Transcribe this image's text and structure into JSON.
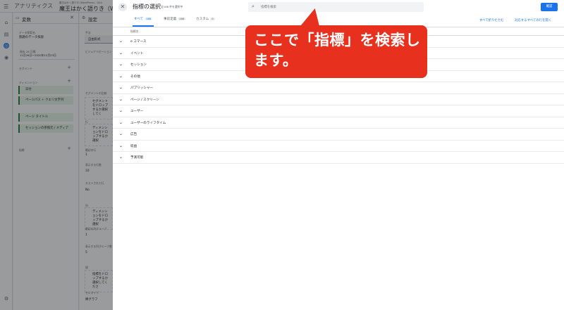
{
  "app": {
    "name": "アナリティクス",
    "property_small": "魔王はかく語りき (WordPress) - GA4",
    "property_title": "魔王はかく語りき（Wo"
  },
  "variables_panel": {
    "title": "変数",
    "exploration_name_label": "データ探索名:",
    "exploration_name": "無題のデータ探索",
    "date_label": "過去 28 日間",
    "date_range": "11月26日～2020年12月23日",
    "segments_label": "セグメント",
    "dimensions_label": "ディメンション",
    "dimensions": [
      "日付",
      "ページパス + クエリ文字列",
      "ページ タイトル",
      "セッションの参照元 / メディア"
    ],
    "metrics_label": "指標"
  },
  "settings_panel": {
    "title": "設定",
    "technique_label": "手法",
    "technique": "自由形式",
    "viz_label": "ビジュアリゼーション",
    "segment_compare_label": "セグメントの比較",
    "segment_drop": "セグメントをドロップするか選択してく",
    "rows_label": "行",
    "rows_drop": "ディメンションをドロップするか選択",
    "start_row_label": "最初の行",
    "start_row": "1",
    "show_rows_label": "表示する行数",
    "show_rows": "10",
    "nested_label": "ネストされた行",
    "nested": "No",
    "cols_label": "列",
    "cols_drop": "ディメンションをドロップするか選択",
    "start_col_group_label": "最初の列グループ",
    "start_col_group": "1",
    "show_col_groups_label": "表示する列グループ数",
    "show_col_groups": "5",
    "values_label": "値",
    "values_drop": "指標をドロップするか選択してくださ",
    "cell_type_label": "セルタイプ",
    "cell_type": "棒グラフ"
  },
  "drawer": {
    "title": "指標の選択",
    "subtitle": "全168 件を選択中",
    "search_placeholder": "指標を検索",
    "apply_label": "確認",
    "tabs": [
      {
        "label": "すべて",
        "count": "168"
      },
      {
        "label": "事前定義",
        "count": "168"
      },
      {
        "label": "カスタム",
        "count": "0"
      }
    ],
    "collapse_all": "すべて折りたたむ",
    "expand_all": "対応するすべての行を開く",
    "column_header": "指標名",
    "categories": [
      "e コマース",
      "イベント",
      "セッション",
      "その他",
      "パブリッシャー",
      "ページ / スクリーン",
      "ユーザー",
      "ユーザーのライフタイム",
      "広告",
      "収益",
      "予測可能"
    ]
  },
  "callout": {
    "text": "ここで「指標」を検索します。",
    "color": "#e8301e"
  },
  "colors": {
    "accent": "#1a73e8",
    "dim_overlay": "#6b6e71"
  }
}
